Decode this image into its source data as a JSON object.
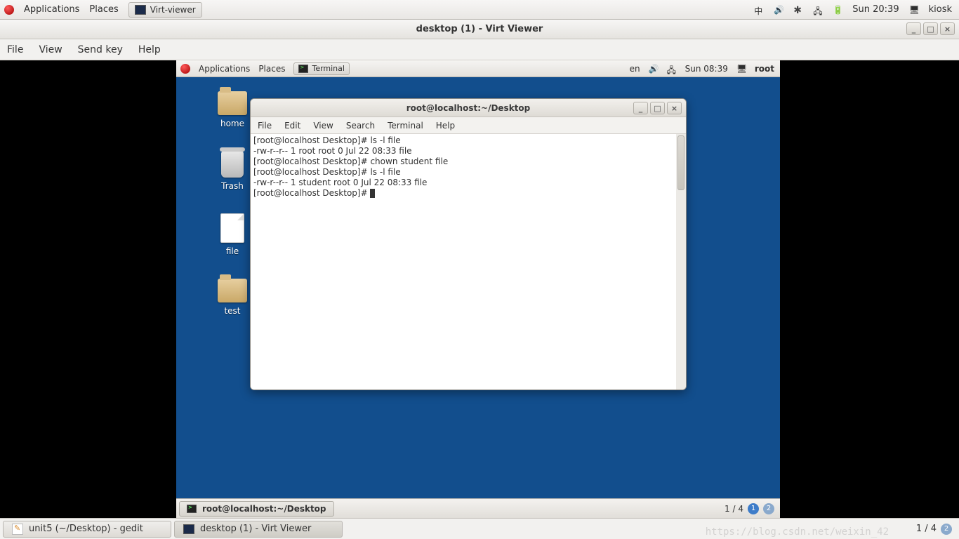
{
  "outer_topbar": {
    "menus": [
      "Applications",
      "Places"
    ],
    "running_app": "Virt-viewer",
    "input_method": "中",
    "clock": "Sun 20:39",
    "user": "kiosk"
  },
  "virt_viewer": {
    "title": "desktop (1) - Virt Viewer",
    "menus": [
      "File",
      "View",
      "Send key",
      "Help"
    ]
  },
  "guest_topbar": {
    "menus": [
      "Applications",
      "Places"
    ],
    "running_app": "Terminal",
    "lang": "en",
    "clock": "Sun 08:39",
    "user": "root"
  },
  "desktop_icons": {
    "home": "home",
    "trash": "Trash",
    "file": "file",
    "test": "test"
  },
  "terminal": {
    "title": "root@localhost:~/Desktop",
    "menus": [
      "File",
      "Edit",
      "View",
      "Search",
      "Terminal",
      "Help"
    ],
    "lines": [
      "[root@localhost Desktop]# ls -l file",
      "-rw-r--r-- 1 root root 0 Jul 22 08:33 file",
      "[root@localhost Desktop]# chown student file",
      "[root@localhost Desktop]# ls -l file",
      "-rw-r--r-- 1 student root 0 Jul 22 08:33 file",
      "[root@localhost Desktop]# "
    ]
  },
  "guest_bottombar": {
    "task": "root@localhost:~/Desktop",
    "workspace": "1 / 4",
    "current_ws": "1",
    "other_ws": "2"
  },
  "outer_bottombar": {
    "tasks": [
      "unit5 (~/Desktop) - gedit",
      "desktop (1) - Virt Viewer"
    ],
    "workspace": "1 / 4",
    "other_ws": "2"
  }
}
